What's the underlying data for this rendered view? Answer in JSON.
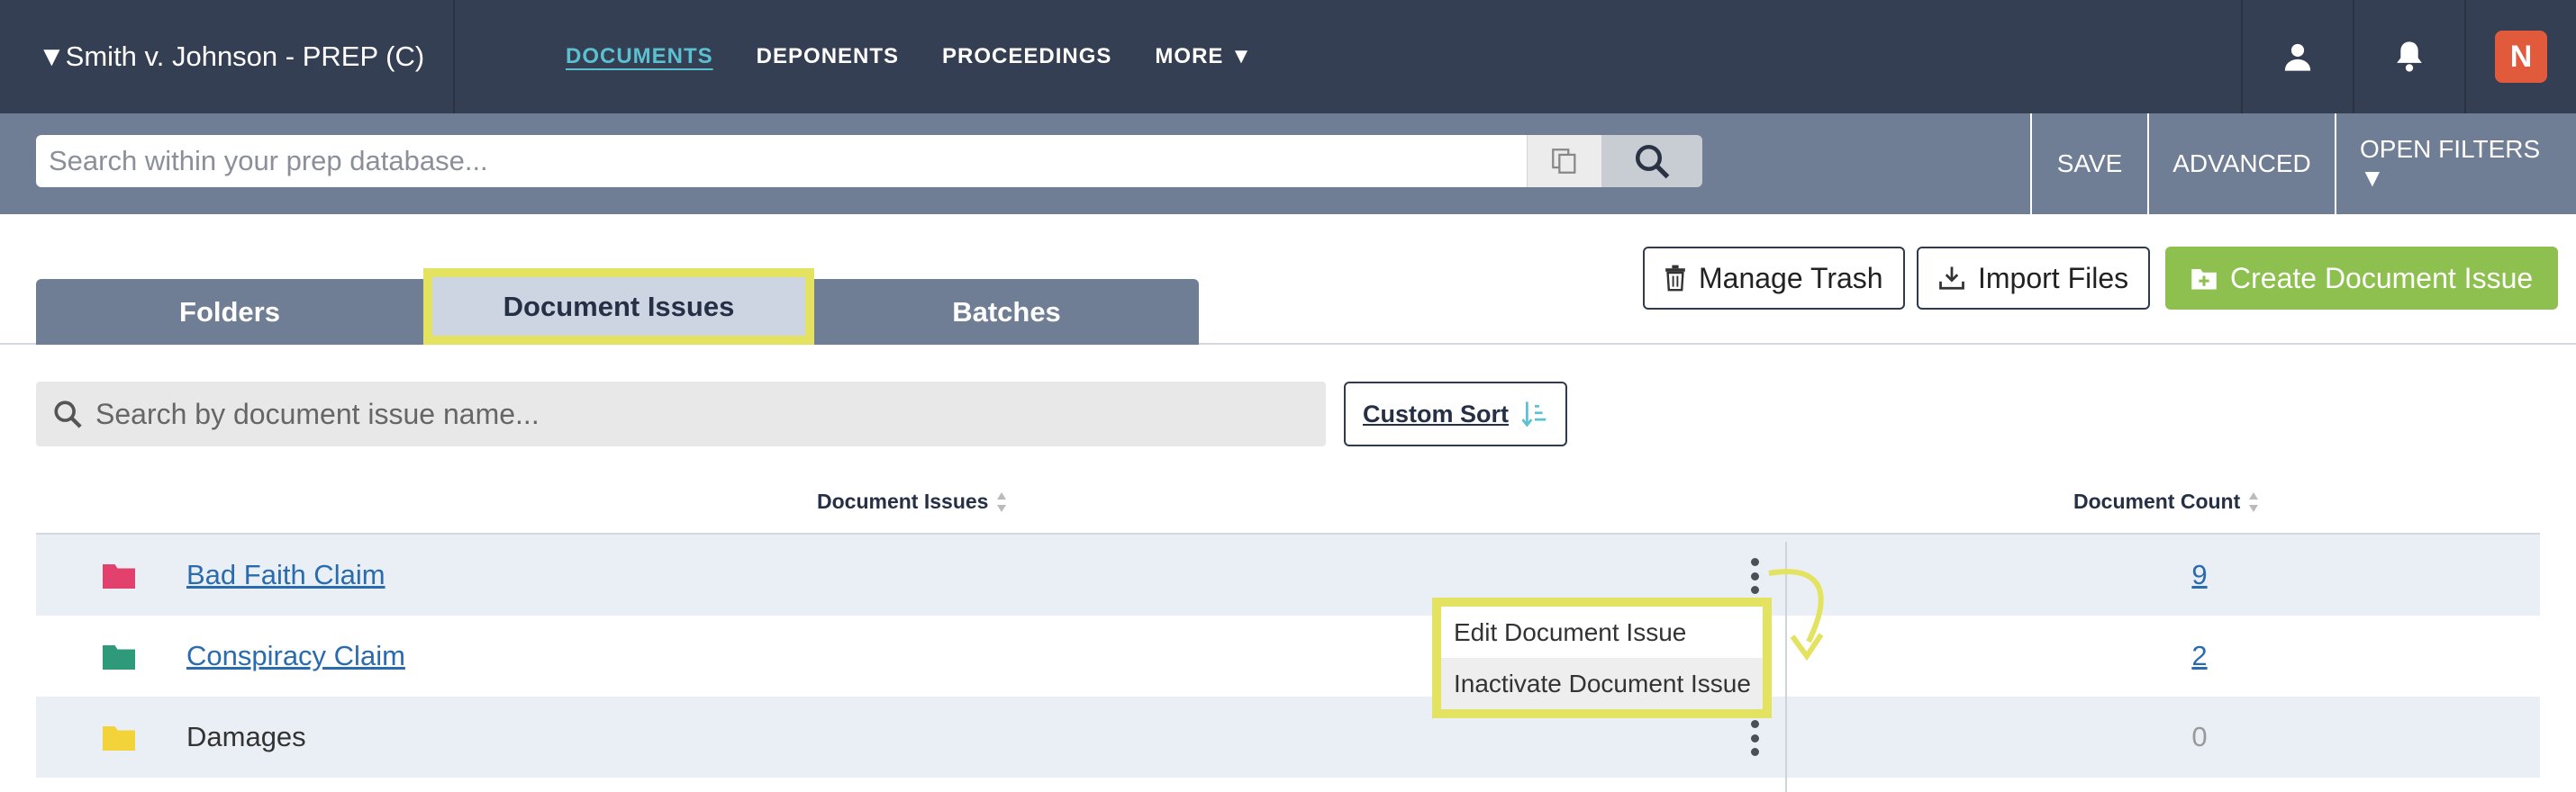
{
  "header": {
    "case_title": "▼Smith v. Johnson - PREP (C)",
    "nav": [
      "DOCUMENTS",
      "DEPONENTS",
      "PROCEEDINGS",
      "MORE ▼"
    ],
    "active_nav": "DOCUMENTS",
    "brand_glyph": "N"
  },
  "searchbar": {
    "placeholder": "Search within your prep database...",
    "save": "SAVE",
    "advanced": "ADVANCED",
    "open_filters": "OPEN FILTERS ▼"
  },
  "tabs": [
    "Folders",
    "Document Issues",
    "Batches"
  ],
  "active_tab": "Document Issues",
  "actions": {
    "manage_trash": "Manage Trash",
    "import_files": "Import Files",
    "create_issue": "Create Document Issue"
  },
  "filter": {
    "placeholder": "Search by document issue name...",
    "custom_sort": "Custom Sort"
  },
  "table": {
    "col_issues": "Document Issues",
    "col_count": "Document Count",
    "rows": [
      {
        "name": "Bad Faith Claim",
        "count": "9",
        "folder_color": "#e2416d"
      },
      {
        "name": "Conspiracy Claim",
        "count": "2",
        "folder_color": "#2f9a7a"
      },
      {
        "name": "Damages",
        "count": "0",
        "folder_color": "#f3d33a"
      }
    ]
  },
  "context_menu": {
    "items": [
      "Edit Document Issue",
      "Inactivate Document Issue"
    ]
  },
  "colors": {
    "topbar": "#353f53",
    "searchbar": "#6f7d95",
    "accent": "#5bc0d0",
    "highlight": "#e3e261",
    "green": "#8dc04e"
  }
}
